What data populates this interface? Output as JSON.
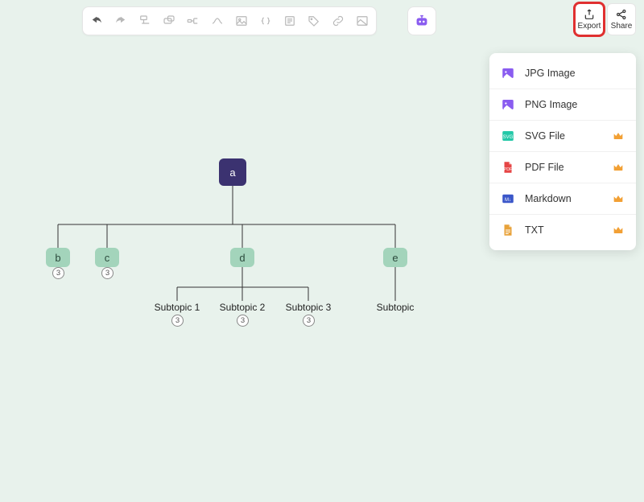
{
  "toolbar": {
    "icons": [
      "undo",
      "redo",
      "format",
      "node-shape",
      "branch",
      "path",
      "image",
      "code",
      "note",
      "tag",
      "link",
      "gallery"
    ]
  },
  "topright": {
    "export_label": "Export",
    "share_label": "Share"
  },
  "export_menu": {
    "items": [
      {
        "label": "JPG Image",
        "color": "#8a5cf0",
        "premium": false,
        "kind": "image"
      },
      {
        "label": "PNG Image",
        "color": "#8a5cf0",
        "premium": false,
        "kind": "image"
      },
      {
        "label": "SVG File",
        "color": "#25c8a8",
        "premium": true,
        "kind": "svg"
      },
      {
        "label": "PDF File",
        "color": "#e64545",
        "premium": true,
        "kind": "pdf"
      },
      {
        "label": "Markdown",
        "color": "#3a56c9",
        "premium": true,
        "kind": "md"
      },
      {
        "label": "TXT",
        "color": "#e8a23a",
        "premium": true,
        "kind": "txt"
      }
    ]
  },
  "mindmap": {
    "root": "a",
    "children": [
      {
        "label": "b",
        "badge": "3"
      },
      {
        "label": "c",
        "badge": "3"
      },
      {
        "label": "d",
        "badge": null,
        "children": [
          {
            "label": "Subtopic 1",
            "badge": "3"
          },
          {
            "label": "Subtopic 2",
            "badge": "3"
          },
          {
            "label": "Subtopic 3",
            "badge": "3"
          }
        ]
      },
      {
        "label": "e",
        "badge": null,
        "children": [
          {
            "label": "Subtopic",
            "badge": null
          }
        ]
      }
    ]
  }
}
